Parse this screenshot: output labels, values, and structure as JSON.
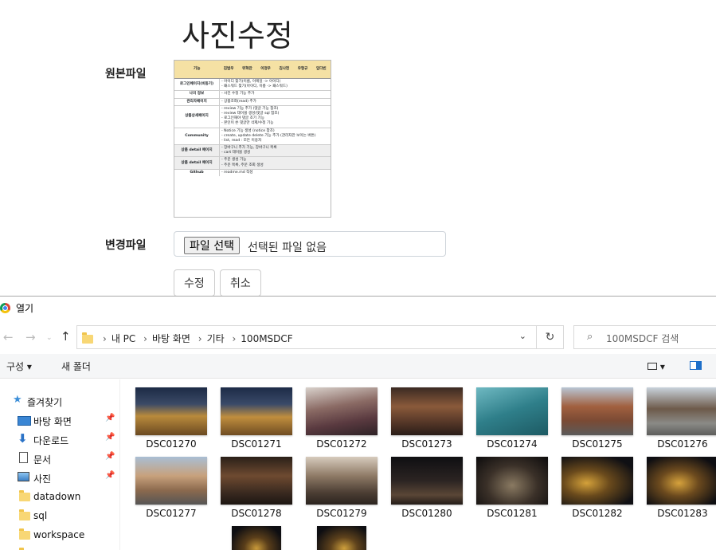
{
  "page": {
    "title": "사진수정",
    "original_label": "원본파일",
    "changed_label": "변경파일",
    "file_button": "파일 선택",
    "file_status": "선택된 파일 없음",
    "submit": "수정",
    "cancel": "취소"
  },
  "preview_table": {
    "headers": [
      "기능",
      "김범우",
      "위혁찬",
      "이정우",
      "김나현",
      "우형규",
      "임다빈"
    ],
    "rows": [
      {
        "section": "로그인페이지(비동기)",
        "items": [
          "- 아이디 찾기(이름, 이메일 -> 아이디)",
          "- 패스워드 찾기(아이디, 이름 -> 패스워드)"
        ]
      },
      {
        "section": "나의 정보",
        "items": [
          "- 사진 수정 기능 추가"
        ]
      },
      {
        "section": "관리자페이지",
        "items": [
          "- 상품조회(read) 추가"
        ]
      },
      {
        "section": "상품상세페이지",
        "items": [
          "- review 기능 추가 (댓글 기능 참조)",
          "- review 테이블 생성(댓글 sql 참조)",
          "- 로그인해야 댓글 조기 기능",
          "- 본인이 쓴 댓글만 삭제/수정 기능"
        ]
      },
      {
        "section": "Community",
        "items": [
          "- Notice 기능 생성 (notice 참조)",
          "- create, update delete 기능 추가 (관리자만 보이는 버튼)",
          "- list, read : 모든 이용자"
        ]
      },
      {
        "section": "상품 detail 페이지",
        "items": [
          "- 장바구니 추가 기능, 장바구니 목록",
          "- cart 테이블 생성"
        ]
      },
      {
        "section": "상품 detail 페이지",
        "items": [
          "- 주문 생성 기능",
          "- 주문 목록, 주문 조회 생성"
        ]
      },
      {
        "section": "Github",
        "items": [
          "- readme.md 작성"
        ]
      }
    ]
  },
  "dialog": {
    "title": "열기",
    "breadcrumbs": [
      "내 PC",
      "바탕 화면",
      "기타",
      "100MSDCF"
    ],
    "search_placeholder": "100MSDCF 검색",
    "organize": "구성 ▾",
    "new_folder": "새 폴더",
    "sidebar": [
      {
        "label": "즐겨찾기",
        "icon": "star-icon",
        "pinned": false
      },
      {
        "label": "바탕 화면",
        "icon": "desktop-icon",
        "pinned": true
      },
      {
        "label": "다운로드",
        "icon": "download-icon",
        "pinned": true
      },
      {
        "label": "문서",
        "icon": "document-icon",
        "pinned": true
      },
      {
        "label": "사진",
        "icon": "pictures-icon",
        "pinned": true
      },
      {
        "label": "datadown",
        "icon": "folder-icon",
        "pinned": false
      },
      {
        "label": "sql",
        "icon": "folder-icon",
        "pinned": false
      },
      {
        "label": "workspace",
        "icon": "folder-icon",
        "pinned": false
      }
    ],
    "files": [
      "DSC01270",
      "DSC01271",
      "DSC01272",
      "DSC01273",
      "DSC01274",
      "DSC01275",
      "DSC01276",
      "DSC01277",
      "DSC01278",
      "DSC01279",
      "DSC01280",
      "DSC01281",
      "DSC01282",
      "DSC01283",
      "",
      ""
    ]
  }
}
